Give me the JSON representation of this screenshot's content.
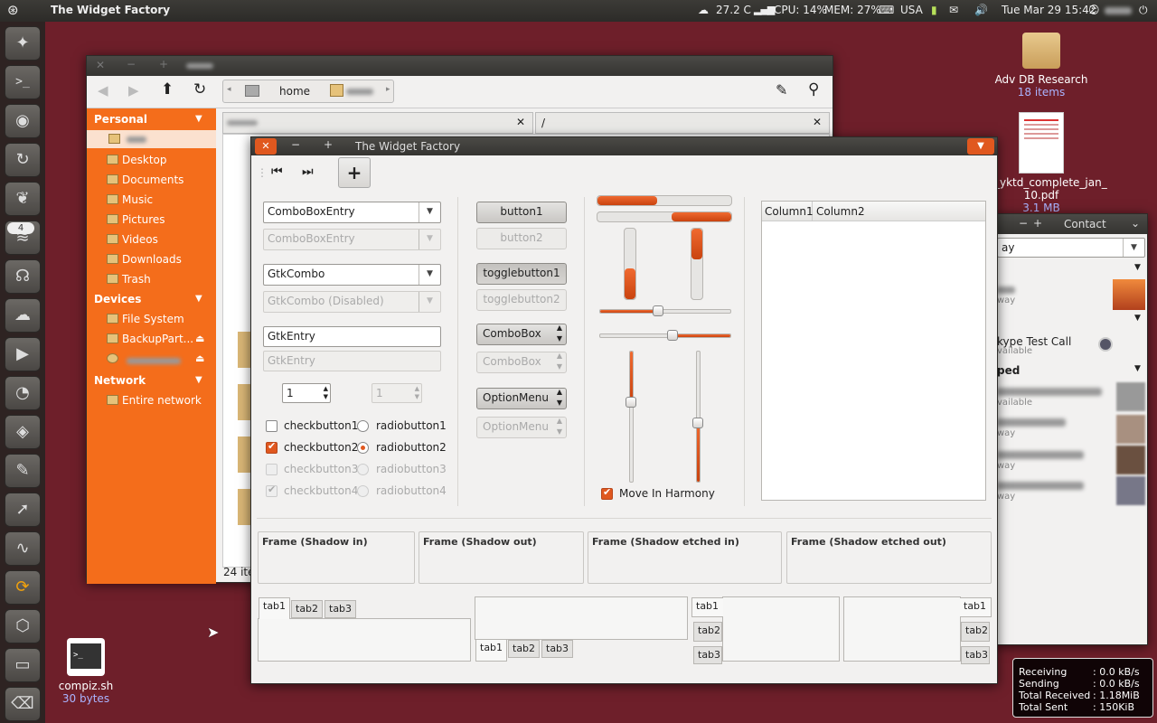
{
  "topbar": {
    "app_title": "The Widget Factory",
    "weather": "27.2 C",
    "cpu": "CPU: 14%",
    "mem": "MEM: 27%",
    "keyboard": "USA",
    "clock": "Tue Mar 29 15:42"
  },
  "desktop": {
    "folder_name": "Adv DB Research",
    "folder_sub": "18 items",
    "pdf_name": "_yktd_complete_jan_",
    "pdf_name2": "10.pdf",
    "pdf_sub": "3.1 MB",
    "script_name": "compiz.sh",
    "script_sub": "30 bytes"
  },
  "launcher": {
    "badge": "4"
  },
  "filemanager": {
    "path_home": "home",
    "path_slash": "/",
    "status": "24 ite",
    "sections": {
      "personal": "Personal",
      "devices": "Devices",
      "network": "Network"
    },
    "personal": [
      "Desktop",
      "Documents",
      "Music",
      "Pictures",
      "Videos",
      "Downloads",
      "Trash"
    ],
    "devices": [
      "File System",
      "BackupPart..."
    ],
    "network": [
      "Entire network"
    ]
  },
  "contacts": {
    "title": "Contact",
    "search_value": "ay",
    "skype": "kype Test Call",
    "skype_status": "vailable",
    "group": "ped",
    "away": "way",
    "available": "vailable"
  },
  "netmon": {
    "rows": [
      {
        "k": "Receiving",
        "v": "0.0 kB/s"
      },
      {
        "k": "Sending",
        "v": "0.0 kB/s"
      },
      {
        "k": "Total Received",
        "v": "1.18MiB"
      },
      {
        "k": "Total Sent",
        "v": "150KiB"
      }
    ]
  },
  "widget": {
    "title": "The Widget Factory",
    "combo_entry": "ComboBoxEntry",
    "combo_entry_dis": "ComboBoxEntry",
    "gtkcombo": "GtkCombo",
    "gtkcombo_dis": "GtkCombo (Disabled)",
    "entry": "GtkEntry",
    "entry_dis": "GtkEntry",
    "spin": "1",
    "spin_dis": "1",
    "check1": "checkbutton1",
    "check2": "checkbutton2",
    "check3": "checkbutton3",
    "check4": "checkbutton4",
    "radio1": "radiobutton1",
    "radio2": "radiobutton2",
    "radio3": "radiobutton3",
    "radio4": "radiobutton4",
    "button1": "button1",
    "button2": "button2",
    "toggle1": "togglebutton1",
    "toggle2": "togglebutton2",
    "combobox": "ComboBox",
    "combobox_dis": "ComboBox",
    "optionmenu": "OptionMenu",
    "optionmenu_dis": "OptionMenu",
    "harmony": "Move In Harmony",
    "col1": "Column1",
    "col2": "Column2",
    "frames": [
      "Frame (Shadow in)",
      "Frame (Shadow out)",
      "Frame (Shadow etched in)",
      "Frame (Shadow etched out)"
    ],
    "tabs": [
      "tab1",
      "tab2",
      "tab3"
    ]
  },
  "colors": {
    "accent": "#f46d1b",
    "desktop": "#6e1f2a"
  }
}
